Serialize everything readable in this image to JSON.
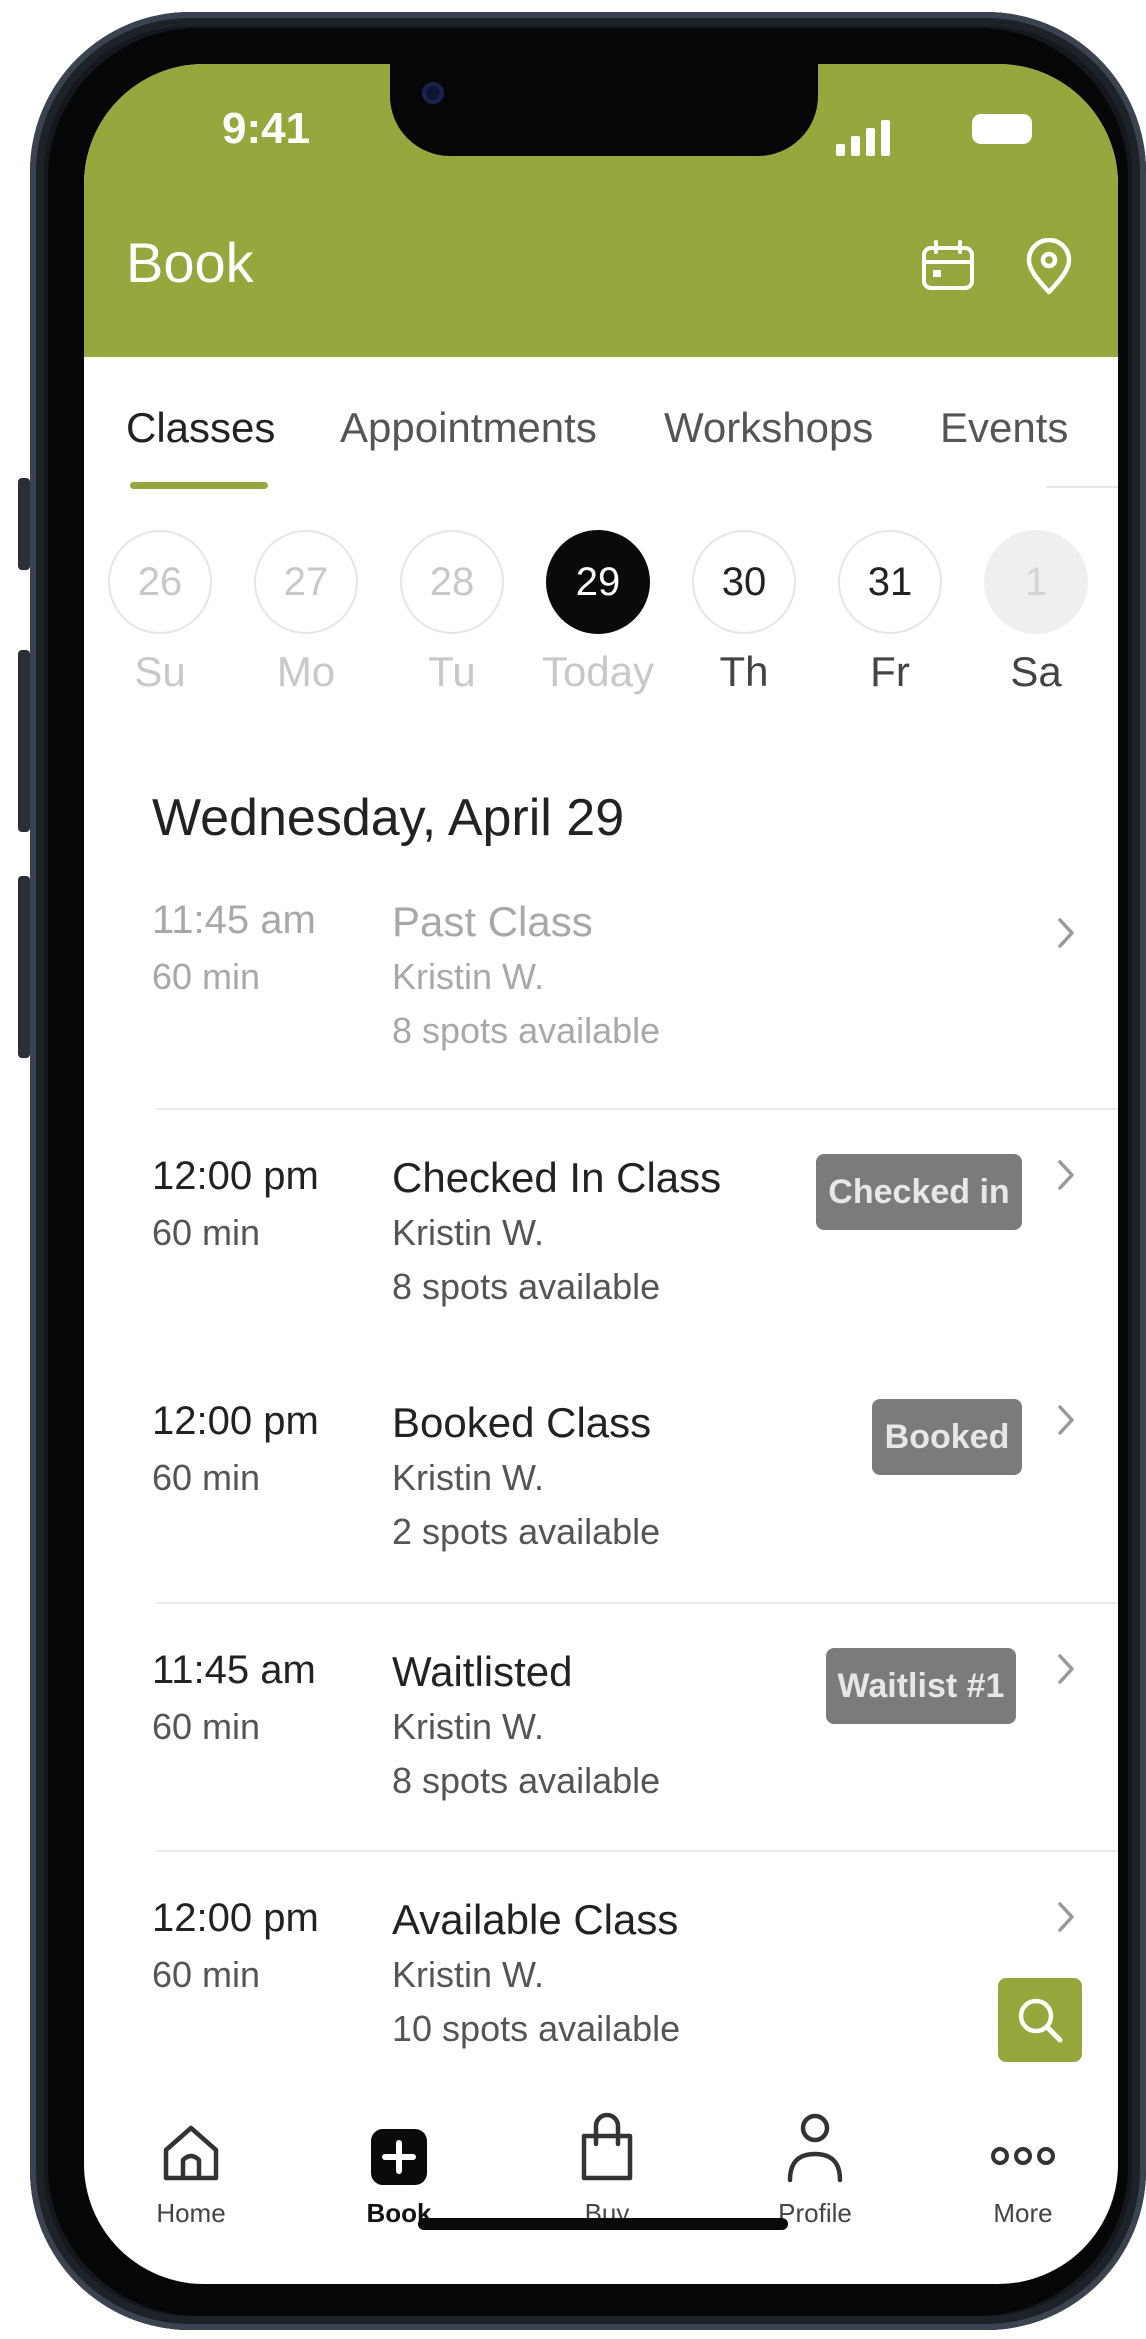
{
  "colors": {
    "accent": "#97a73e",
    "badge": "#7b7b7b",
    "today": "#0a0a0a"
  },
  "status_bar": {
    "time": "9:41"
  },
  "header": {
    "title": "Book",
    "icons": [
      "calendar-icon",
      "location-pin-icon"
    ]
  },
  "tabs": [
    {
      "label": "Classes",
      "selected": true
    },
    {
      "label": "Appointments",
      "selected": false
    },
    {
      "label": "Workshops",
      "selected": false
    },
    {
      "label": "Events",
      "selected": false
    }
  ],
  "days": [
    {
      "num": "26",
      "label": "Su",
      "state": "past"
    },
    {
      "num": "27",
      "label": "Mo",
      "state": "past"
    },
    {
      "num": "28",
      "label": "Tu",
      "state": "past"
    },
    {
      "num": "29",
      "label": "Today",
      "state": "today"
    },
    {
      "num": "30",
      "label": "Th",
      "state": "future"
    },
    {
      "num": "31",
      "label": "Fr",
      "state": "future"
    },
    {
      "num": "1",
      "label": "Sa",
      "state": "disabled"
    }
  ],
  "schedule": {
    "date_heading": "Wednesday, April 29",
    "classes": [
      {
        "time": "11:45 am",
        "duration": "60 min",
        "name": "Past Class",
        "instructor": "Kristin W.",
        "spots": "8 spots available",
        "badge": ""
      },
      {
        "time": "12:00 pm",
        "duration": "60 min",
        "name": "Checked In Class",
        "instructor": "Kristin W.",
        "spots": "8 spots available",
        "badge": "Checked in"
      },
      {
        "time": "12:00 pm",
        "duration": "60 min",
        "name": "Booked Class",
        "instructor": "Kristin W.",
        "spots": "2 spots available",
        "badge": "Booked"
      },
      {
        "time": "11:45 am",
        "duration": "60 min",
        "name": "Waitlisted",
        "instructor": "Kristin W.",
        "spots": "8 spots available",
        "badge": "Waitlist #1"
      },
      {
        "time": "12:00 pm",
        "duration": "60 min",
        "name": "Available Class",
        "instructor": "Kristin W.",
        "spots": "10 spots available",
        "badge": ""
      }
    ]
  },
  "bottom_nav": [
    {
      "label": "Home",
      "icon": "home-icon",
      "active": false
    },
    {
      "label": "Book",
      "icon": "plus-icon",
      "active": true
    },
    {
      "label": "Buy",
      "icon": "shopping-bag-icon",
      "active": false
    },
    {
      "label": "Profile",
      "icon": "person-icon",
      "active": false
    },
    {
      "label": "More",
      "icon": "more-dots-icon",
      "active": false
    }
  ]
}
